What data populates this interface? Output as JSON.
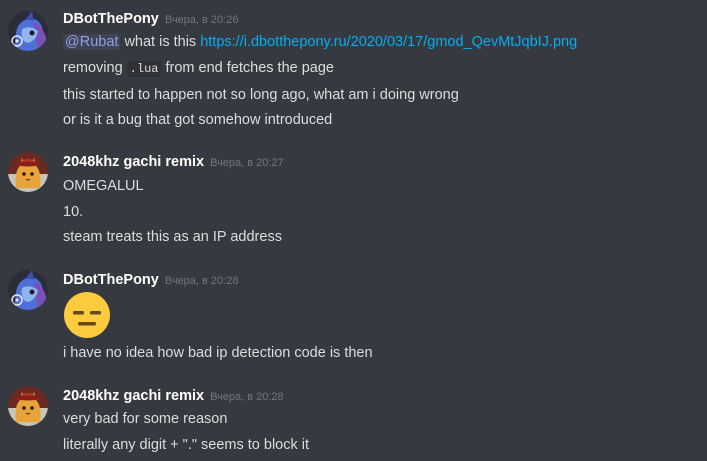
{
  "messages": [
    {
      "username": "DBotThePony",
      "timestamp": "Вчера, в 20:26",
      "lines": {
        "l1": {
          "mention": "@Rubat",
          "text": " what is this ",
          "link": "https://i.dbotthepony.ru/2020/03/17/gmod_QevMtJqbIJ.png"
        },
        "l2": {
          "pre": "removing ",
          "code": ".lua",
          "post": " from end fetches the page"
        },
        "l3": "this started to happen not so long ago, what am i doing wrong",
        "l4": "or is it a bug that got somehow introduced"
      }
    },
    {
      "username": "2048khz gachi remix",
      "timestamp": "Вчера, в 20:27",
      "lines": {
        "l1": "OMEGALUL",
        "l2": "10.",
        "l3": "steam treats this as an IP address"
      }
    },
    {
      "username": "DBotThePony",
      "timestamp": "Вчера, в 20:28",
      "emoji": "expressionless-face-emoji",
      "lines": {
        "l1": "i have no idea how bad ip detection code is then"
      }
    },
    {
      "username": "2048khz gachi remix",
      "timestamp": "Вчера, в 20:28",
      "lines": {
        "l1": "very bad for some reason",
        "l2": "literally any digit + \".\" seems to block it"
      }
    }
  ],
  "colors": {
    "background": "#36393f",
    "username": "#ffffff",
    "timestamp": "#72767d",
    "text": "#dcddde",
    "link": "#00b0f4",
    "mention": "#8ea1e1"
  }
}
